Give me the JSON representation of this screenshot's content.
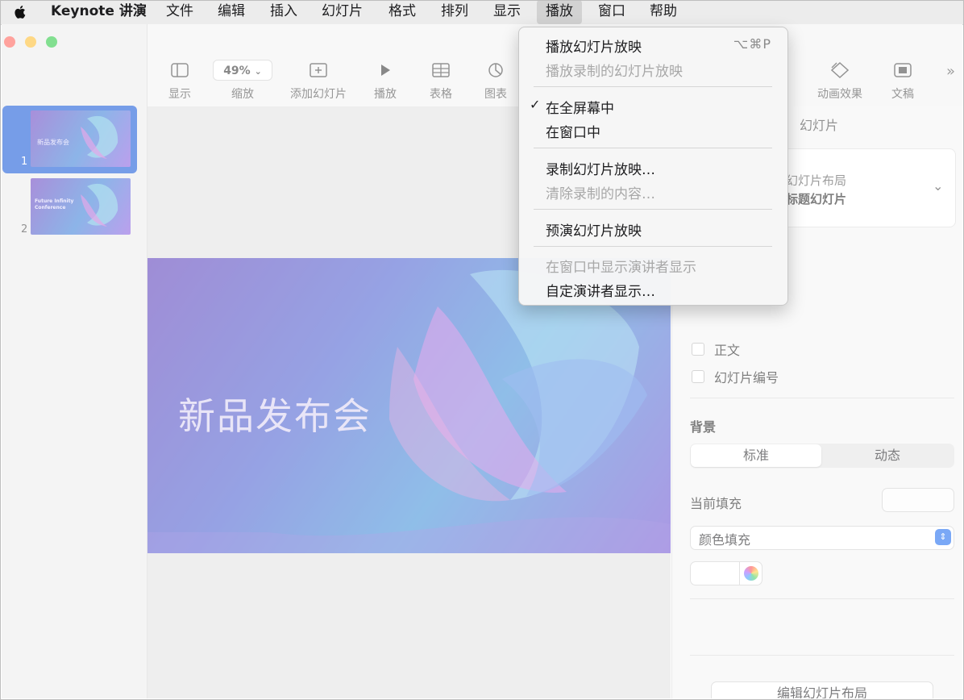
{
  "menubar": {
    "app_name": "Keynote 讲演",
    "menus": [
      "文件",
      "编辑",
      "插入",
      "幻灯片",
      "格式",
      "排列",
      "显示",
      "播放",
      "窗口",
      "帮助"
    ]
  },
  "toolbar": {
    "view_label": "显示",
    "zoom_value": "49%",
    "zoom_label": "缩放",
    "add_slide_label": "添加幻灯片",
    "play_label": "播放",
    "table_label": "表格",
    "chart_label": "图表",
    "animate_label": "动画效果",
    "document_label": "文稿"
  },
  "slides": {
    "items": [
      {
        "number": "1",
        "title": "新品发布会"
      },
      {
        "number": "2",
        "title": "Future Infinity Conference"
      }
    ]
  },
  "slide": {
    "title": "新品发布会"
  },
  "inspector": {
    "tab": "幻灯片",
    "layout_label": "幻灯片布局",
    "layout_value": "标题幻灯片",
    "body_checkbox": "正文",
    "slide_number_checkbox": "幻灯片编号",
    "background_label": "背景",
    "segment_standard": "标准",
    "segment_dynamic": "动态",
    "current_fill_label": "当前填充",
    "fill_type": "颜色填充",
    "edit_layout_button": "编辑幻灯片布局"
  },
  "play_menu": {
    "items": [
      {
        "label": "播放幻灯片放映",
        "shortcut": "⌥⌘P",
        "enabled": true
      },
      {
        "label": "播放录制的幻灯片放映",
        "enabled": false
      },
      {
        "label": "在全屏幕中",
        "checked": true,
        "enabled": true
      },
      {
        "label": "在窗口中",
        "enabled": true
      },
      {
        "label": "录制幻灯片放映…",
        "enabled": true
      },
      {
        "label": "清除录制的内容…",
        "enabled": false
      },
      {
        "label": "预演幻灯片放映",
        "enabled": true
      },
      {
        "label": "在窗口中显示演讲者显示",
        "enabled": false
      },
      {
        "label": "自定演讲者显示…",
        "enabled": true
      }
    ]
  },
  "colors": {
    "selection_blue": "#1456d8",
    "traffic_red": "#ff5f57",
    "traffic_yellow": "#febc2e",
    "traffic_green": "#28c840"
  }
}
